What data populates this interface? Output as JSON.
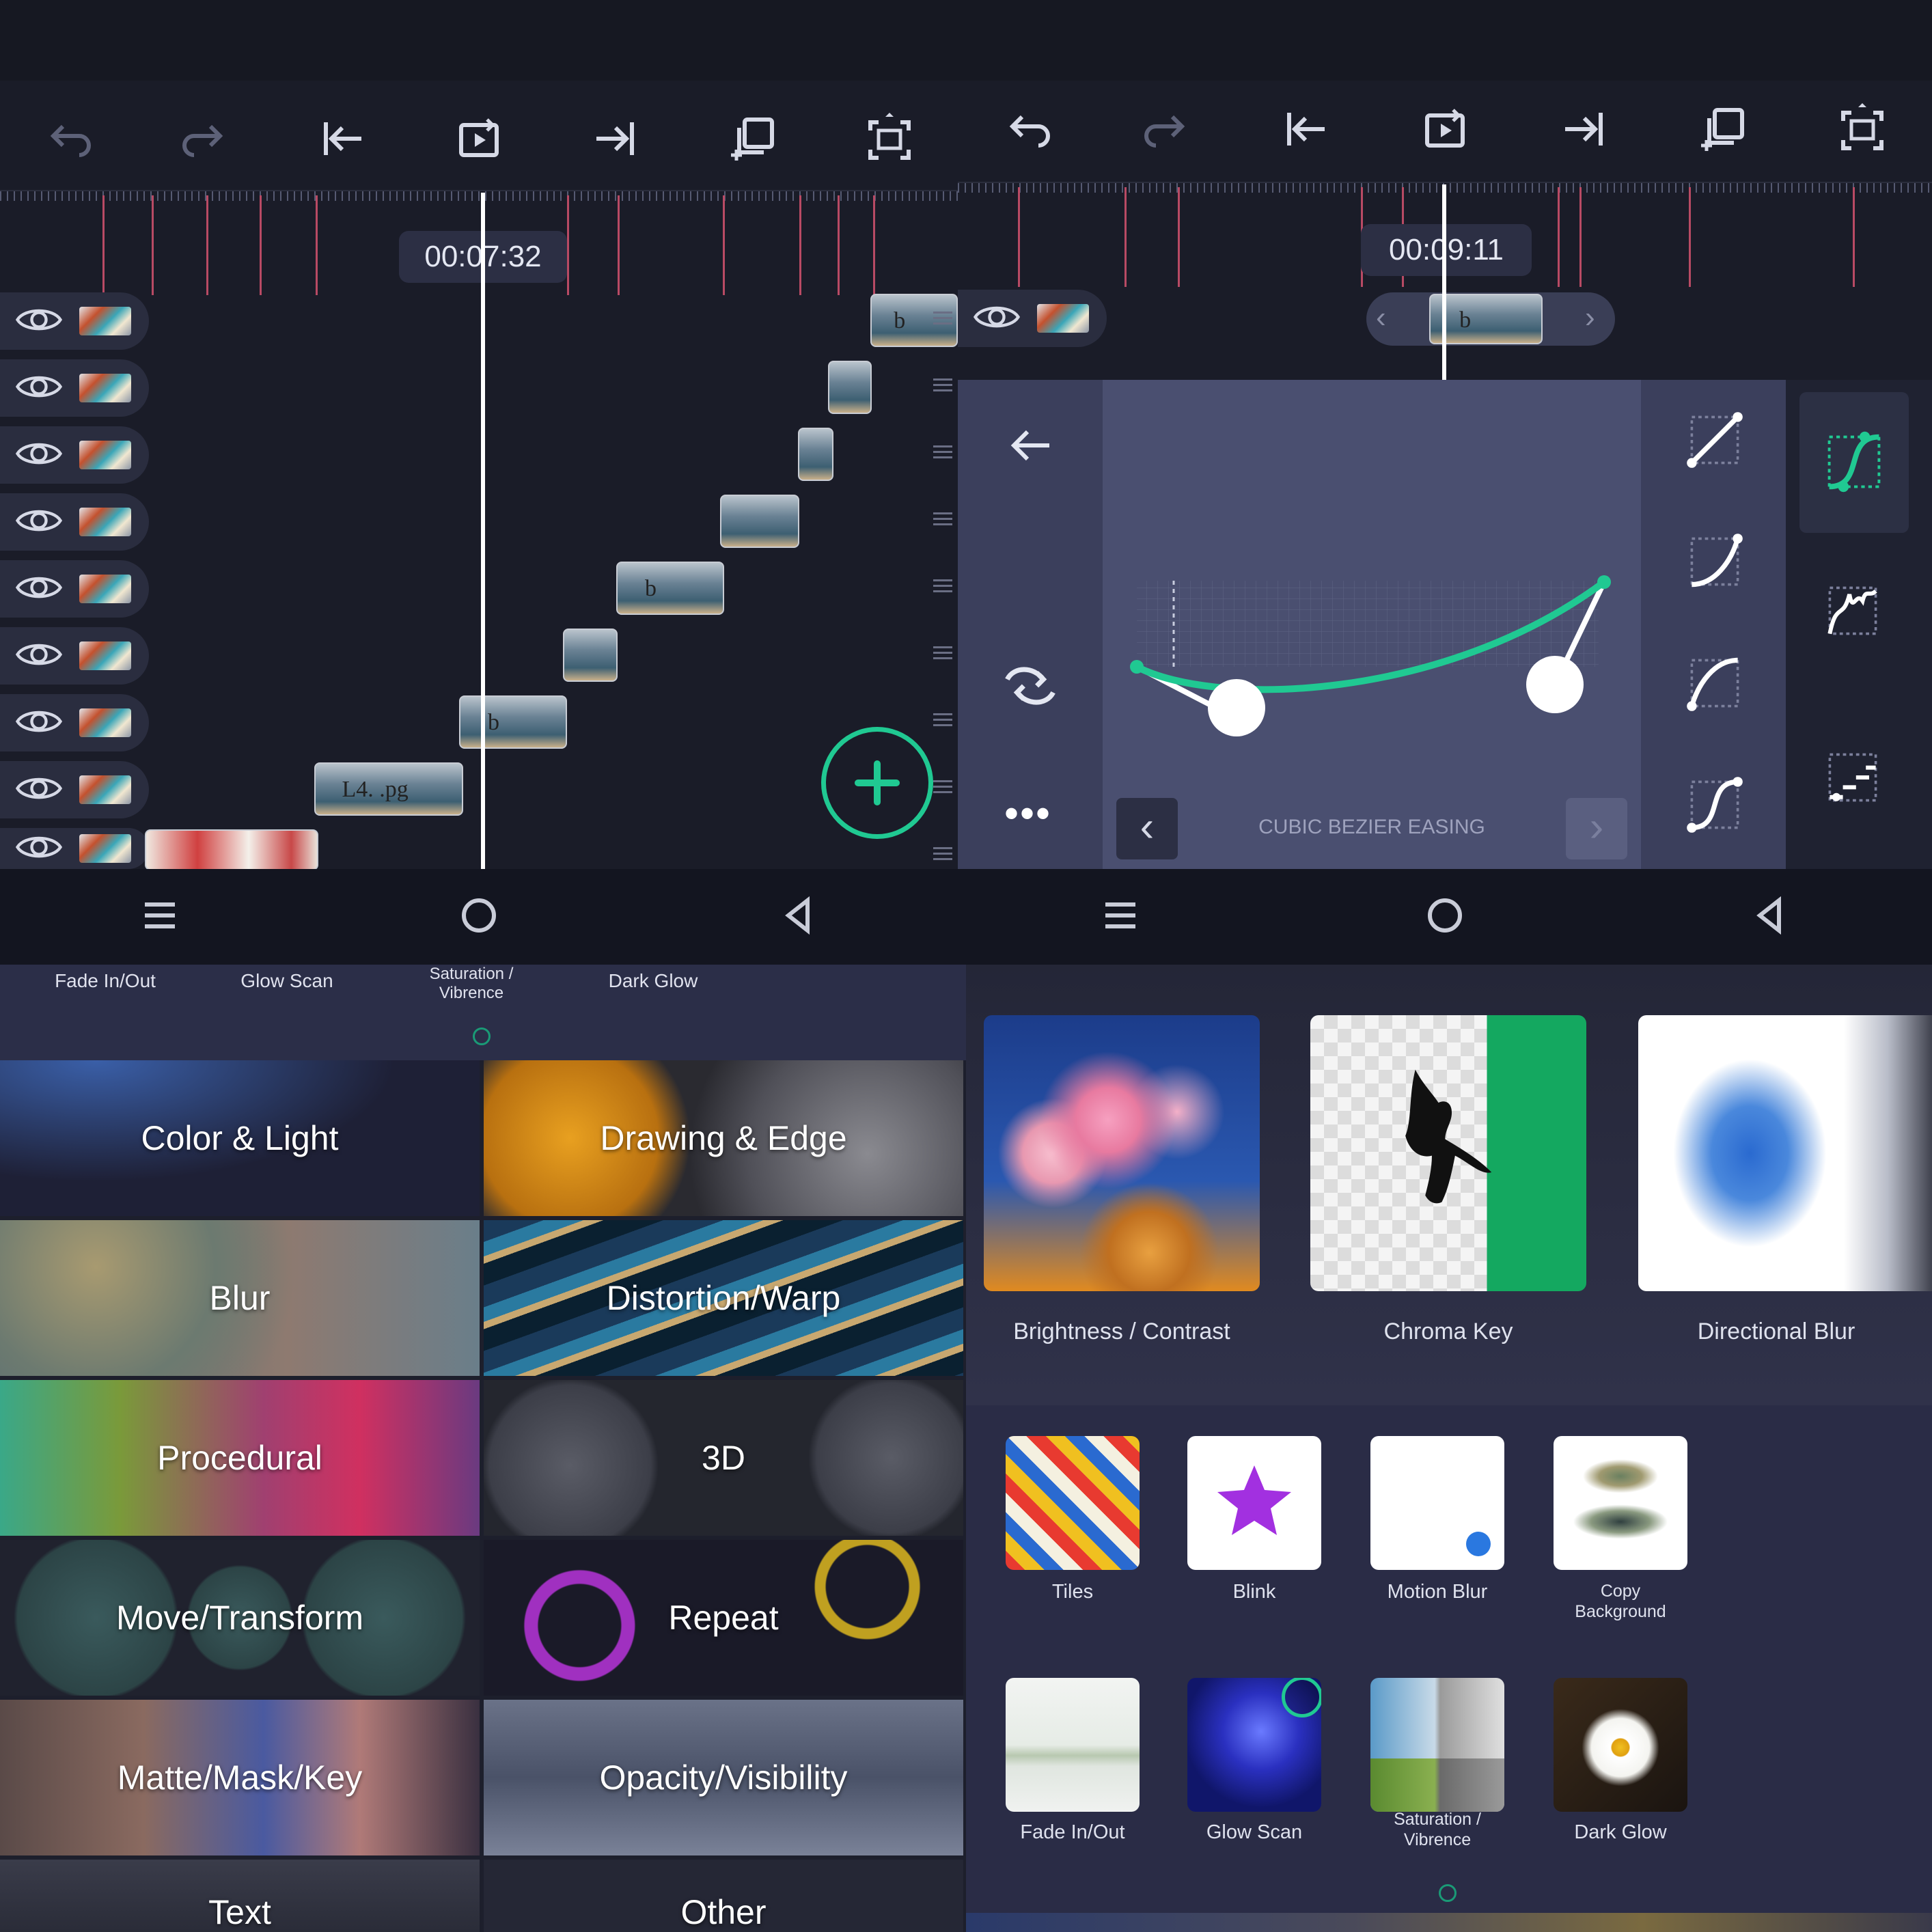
{
  "screen1": {
    "timecode": "00:07:32",
    "clip_labels": [
      "b",
      "b",
      "b",
      "L4. .pg"
    ],
    "toolbar": [
      "undo-icon",
      "redo-icon",
      "skip-start-icon",
      "loop-icon",
      "skip-end-icon",
      "copy-icon",
      "fullscreen-icon"
    ],
    "fab": "add-icon"
  },
  "screen2": {
    "timecode": "00:09:11",
    "clip_label": "b",
    "easing_label": "CUBIC BEZIER EASING"
  },
  "screen3": {
    "strip_labels": [
      "Fade In/Out",
      "Glow Scan",
      "Saturation /\nVibrence",
      "Dark Glow"
    ],
    "categories": [
      "Color & Light",
      "Drawing & Edge",
      "Blur",
      "Distortion/Warp",
      "Procedural",
      "3D",
      "Move/Transform",
      "Repeat",
      "Matte/Mask/Key",
      "Opacity/Visibility",
      "Text",
      "Other"
    ]
  },
  "screen4": {
    "featured": [
      "Brightness / Contrast",
      "Chroma Key",
      "Directional Blur"
    ],
    "row1": [
      "Tiles",
      "Blink",
      "Motion Blur",
      "Copy\nBackground"
    ],
    "row2": [
      "Fade In/Out",
      "Glow Scan",
      "Saturation /\nVibrence",
      "Dark Glow"
    ]
  },
  "colors": {
    "accent": "#20c992",
    "marker": "#b84a64",
    "panel": "#4a4f70"
  }
}
